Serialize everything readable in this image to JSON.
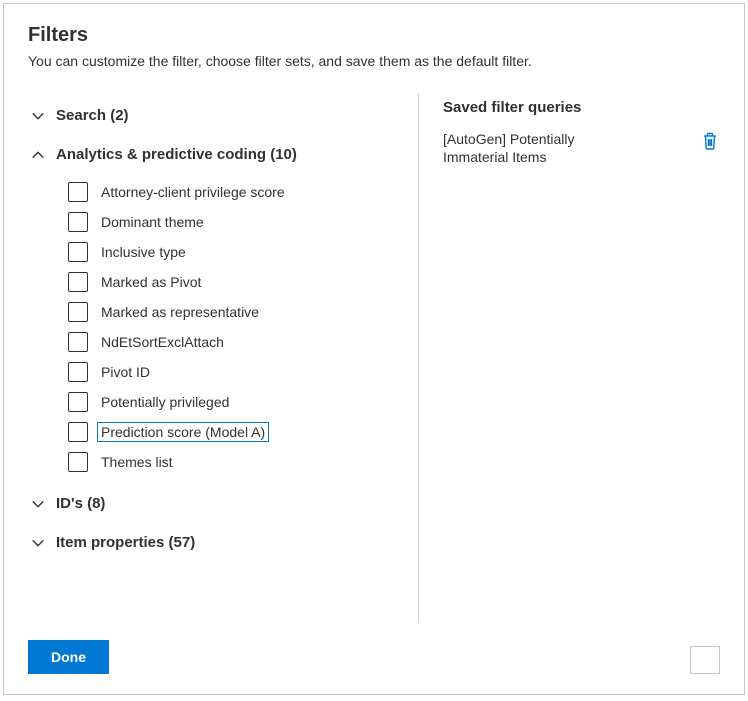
{
  "header": {
    "title": "Filters",
    "subtitle": "You can customize the filter, choose filter sets, and save them as the default filter."
  },
  "sections": {
    "search": {
      "label": "Search (2)",
      "expanded": false
    },
    "analytics": {
      "label": "Analytics & predictive coding (10)",
      "expanded": true,
      "options": [
        "Attorney-client privilege score",
        "Dominant theme",
        "Inclusive type",
        "Marked as Pivot",
        "Marked as representative",
        "NdEtSortExclAttach",
        "Pivot ID",
        "Potentially privileged",
        "Prediction score (Model A)",
        "Themes list"
      ],
      "highlighted_index": 8
    },
    "ids": {
      "label": "ID's (8)",
      "expanded": false
    },
    "item_props": {
      "label": "Item properties (57)",
      "expanded": false
    }
  },
  "saved": {
    "heading": "Saved filter queries",
    "items": [
      {
        "label": "[AutoGen] Potentially Immaterial Items"
      }
    ]
  },
  "footer": {
    "done_label": "Done"
  }
}
